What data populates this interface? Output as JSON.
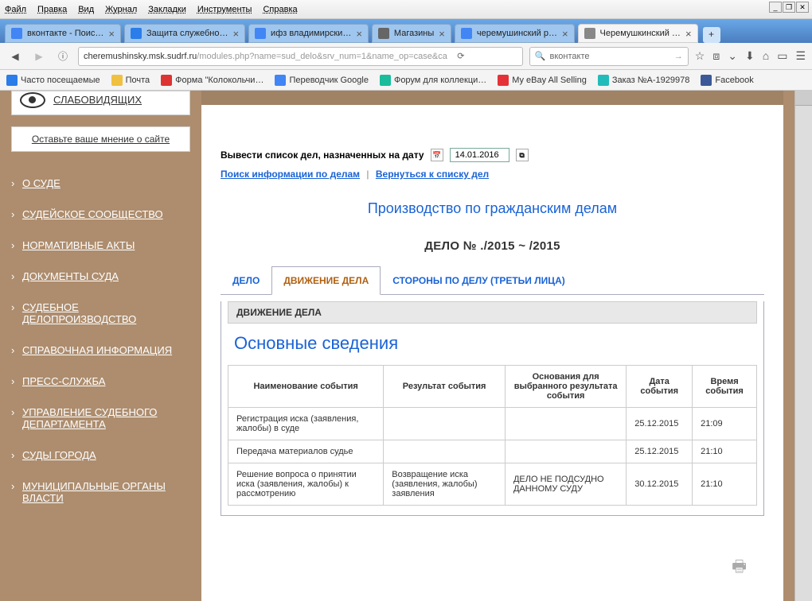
{
  "menu": [
    "Файл",
    "Правка",
    "Вид",
    "Журнал",
    "Закладки",
    "Инструменты",
    "Справка"
  ],
  "tabs": [
    {
      "label": "вконтакте - Поис…",
      "fav": "#4285f4",
      "active": false
    },
    {
      "label": "Защита служебно…",
      "fav": "#2b7de9",
      "active": false
    },
    {
      "label": "ифз владимирски…",
      "fav": "#4285f4",
      "active": false
    },
    {
      "label": "Магазины",
      "fav": "#666",
      "active": false
    },
    {
      "label": "черемушинский р…",
      "fav": "#4285f4",
      "active": false
    },
    {
      "label": "Черемушкинский …",
      "fav": "#888",
      "active": true
    }
  ],
  "url": {
    "host": "cheremushinsky.msk.sudrf.ru",
    "path": "/modules.php?name=sud_delo&srv_num=1&name_op=case&ca"
  },
  "search": {
    "value": "вконтакте"
  },
  "bookmarks": [
    {
      "label": "Часто посещаемые",
      "c": "#2b7de9"
    },
    {
      "label": "Почта",
      "c": "#f0c040"
    },
    {
      "label": "Форма \"Колокольчи…",
      "c": "#d33"
    },
    {
      "label": "Переводчик Google",
      "c": "#4285f4"
    },
    {
      "label": "Форум для коллекци…",
      "c": "#1abc9c"
    },
    {
      "label": "My eBay All Selling",
      "c": "#e53238"
    },
    {
      "label": "Заказ №A-1929978",
      "c": "#2bb"
    },
    {
      "label": "Facebook",
      "c": "#3b5998"
    }
  ],
  "sidebar": {
    "eye_label": "СЛАБОВИДЯЩИХ",
    "opinion": "Оставьте ваше мнение о сайте",
    "items": [
      "О СУДЕ",
      "СУДЕЙСКОЕ СООБЩЕСТВО",
      "НОРМАТИВНЫЕ АКТЫ",
      "ДОКУМЕНТЫ СУДА",
      "СУДЕБНОЕ ДЕЛОПРОИЗВОДСТВО",
      "СПРАВОЧНАЯ ИНФОРМАЦИЯ",
      "ПРЕСС-СЛУЖБА",
      "УПРАВЛЕНИЕ СУДЕБНОГО ДЕПАРТАМЕНТА",
      "СУДЫ ГОРОДА",
      "МУНИЦИПАЛЬНЫЕ ОРГАНЫ ВЛАСТИ"
    ]
  },
  "main": {
    "date_label": "Вывести список дел, назначенных на дату",
    "date_value": "14.01.2016",
    "link_search": "Поиск информации по делам",
    "link_back": "Вернуться к списку дел",
    "section": "Производство по гражданским делам",
    "case": "ДЕЛО №        ./2015 ~            /2015",
    "inner_tabs": [
      "ДЕЛО",
      "ДВИЖЕНИЕ ДЕЛА",
      "СТОРОНЫ ПО ДЕЛУ (ТРЕТЬИ ЛИЦА)"
    ],
    "active_tab": 1,
    "panel_head": "ДВИЖЕНИЕ ДЕЛА",
    "panel_title": "Основные сведения",
    "headers": [
      "Наименование события",
      "Результат события",
      "Основания для выбранного результата события",
      "Дата события",
      "Время события"
    ],
    "rows": [
      {
        "c": [
          "Регистрация иска (заявления, жалобы) в суде",
          "",
          "",
          "25.12.2015",
          "21:09"
        ]
      },
      {
        "c": [
          "Передача материалов судье",
          "",
          "",
          "25.12.2015",
          "21:10"
        ]
      },
      {
        "c": [
          "Решение вопроса о принятии иска (заявления, жалобы) к рассмотрению",
          "Возвращение иска (заявления, жалобы) заявления",
          "ДЕЛО НЕ ПОДСУДНО ДАННОМУ СУДУ",
          "30.12.2015",
          "21:10"
        ]
      }
    ]
  }
}
